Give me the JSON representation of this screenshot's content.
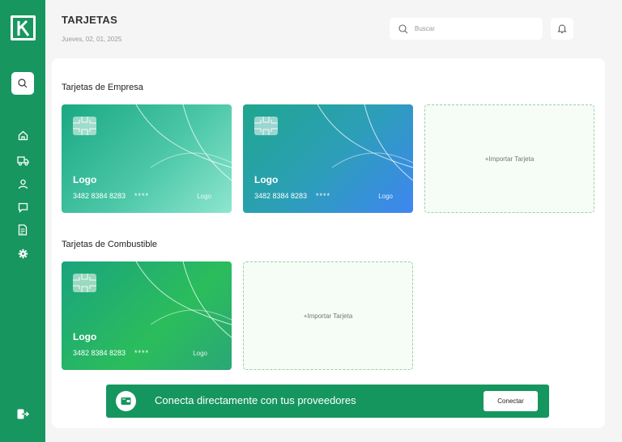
{
  "header": {
    "title": "TARJETAS",
    "date": "Jueves, 02, 01, 2025"
  },
  "search": {
    "placeholder": "Buscar"
  },
  "sidebar": {
    "items": [
      {
        "name": "home-icon"
      },
      {
        "name": "truck-icon"
      },
      {
        "name": "user-icon"
      },
      {
        "name": "chat-icon"
      },
      {
        "name": "document-icon"
      },
      {
        "name": "gear-icon"
      }
    ],
    "logout_icon": "logout-icon"
  },
  "sections": {
    "empresa": {
      "title": "Tarjetas de Empresa",
      "cards": [
        {
          "brand": "Logo",
          "number": "3482 8384 8283",
          "mask": "****",
          "mini": "Logo"
        },
        {
          "brand": "Logo",
          "number": "3482 8384 8283",
          "mask": "****",
          "mini": "Logo"
        }
      ],
      "import_label": "+Importar Tarjeta"
    },
    "combustible": {
      "title": "Tarjetas de Combustible",
      "cards": [
        {
          "brand": "Logo",
          "number": "3482 8384 8283",
          "mask": "****",
          "mini": "Logo"
        }
      ],
      "import_label": "+Importar Tarjeta"
    }
  },
  "banner": {
    "text": "Conecta directamente con tus proveedores",
    "button_label": "Conectar"
  },
  "colors": {
    "primary": "#17965f",
    "panel": "#ffffff",
    "background": "#f4f5f4"
  }
}
